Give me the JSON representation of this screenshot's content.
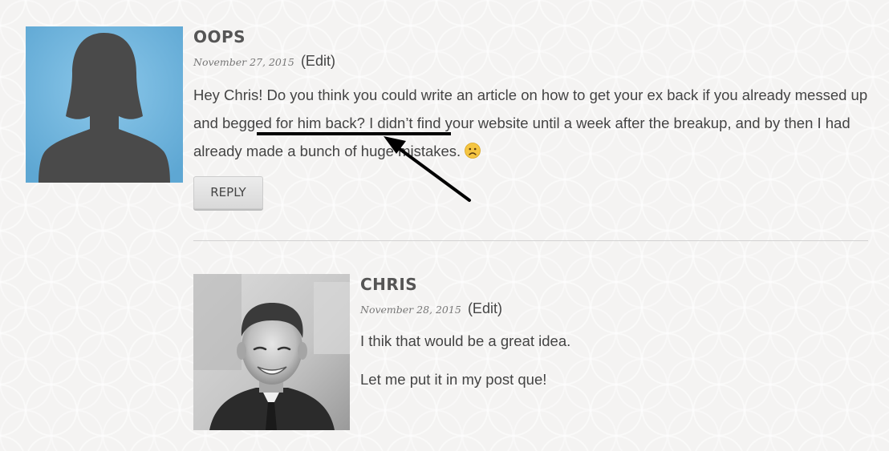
{
  "comments": [
    {
      "author": "OOPS",
      "date": "November 27, 2015",
      "edit_label": "(Edit)",
      "text_parts": {
        "before_underline": "Hey Chris! Do you think you could write an article on how to get your ex back if you already messed ",
        "underlined": "up and begged for him back",
        "after_underline": "? I didn’t find your website until a week after the breakup, and by then I had already made a bunch of huge mistakes. "
      },
      "emoji": "frowning-face-icon",
      "reply_label": "REPLY"
    },
    {
      "author": "CHRIS",
      "date": "November 28, 2015",
      "edit_label": "(Edit)",
      "paragraphs": [
        "I thik that would be a great idea.",
        "Let me put it in my post que!"
      ]
    }
  ],
  "colors": {
    "avatar_bg": "#6fb4dc",
    "silhouette": "#4a4a4a",
    "annotation": "#000000",
    "emoji": "#f5c542"
  }
}
